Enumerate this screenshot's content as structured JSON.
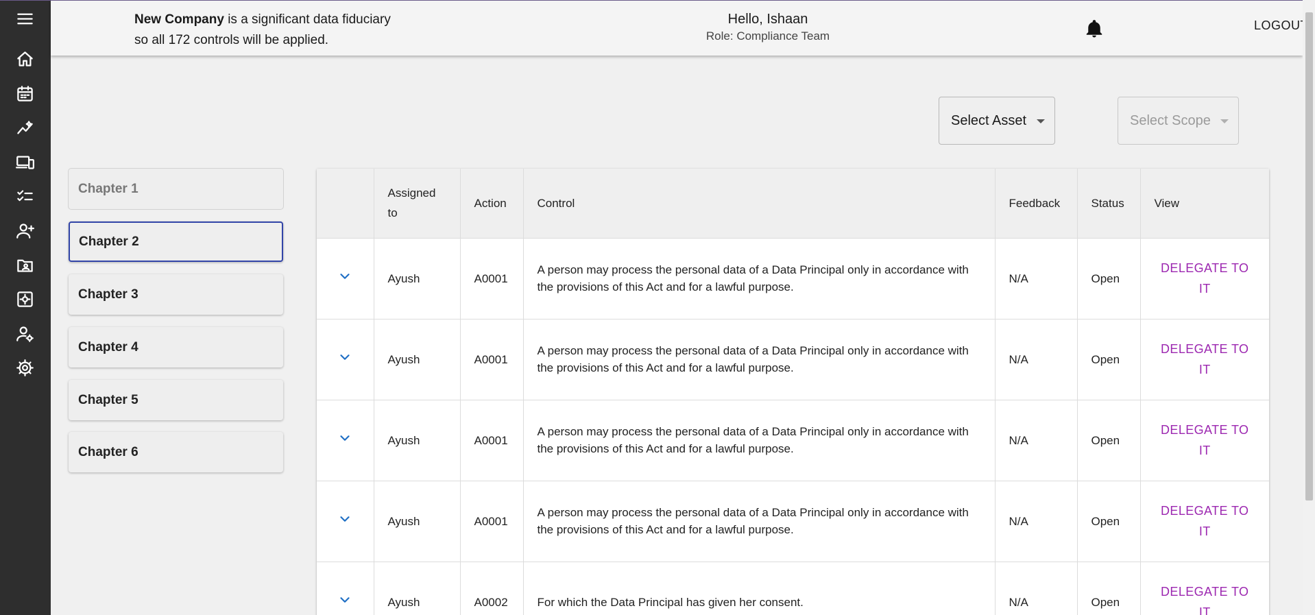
{
  "header": {
    "company_name": "New Company",
    "company_msg_rest": " is a significant data fiduciary",
    "company_msg_line2": "so all 172 controls will be applied.",
    "greeting": "Hello, Ishaan",
    "role": "Role: Compliance Team",
    "logout_label": "LOGOUT",
    "bell_icon": "bell-icon"
  },
  "rail": {
    "items": [
      {
        "icon": "menu-icon"
      },
      {
        "icon": "home-icon"
      },
      {
        "icon": "calendar-icon"
      },
      {
        "icon": "analytics-icon"
      },
      {
        "icon": "devices-icon"
      },
      {
        "icon": "checklist-icon"
      },
      {
        "icon": "add-user-icon"
      },
      {
        "icon": "folder-user-icon"
      },
      {
        "icon": "settings-box-icon"
      },
      {
        "icon": "user-settings-icon"
      },
      {
        "icon": "gear-icon"
      }
    ]
  },
  "filters": {
    "asset_label": "Select Asset",
    "scope_label": "Select Scope"
  },
  "chapters": [
    "Chapter 1",
    "Chapter 2",
    "Chapter 3",
    "Chapter 4",
    "Chapter 5",
    "Chapter 6"
  ],
  "table": {
    "headers": {
      "assigned": "Assigned to",
      "action": "Action",
      "control": "Control",
      "feedback": "Feedback",
      "status": "Status",
      "view": "View"
    },
    "rows": [
      {
        "assigned": "Ayush",
        "action": "A0001",
        "control": "A person may process the personal data of a Data Principal only in accordance with the provisions of this Act and for a lawful purpose.",
        "feedback": "N/A",
        "status": "Open",
        "view": "DELEGATE TO IT"
      },
      {
        "assigned": "Ayush",
        "action": "A0001",
        "control": "A person may process the personal data of a Data Principal only in accordance with the provisions of this Act and for a lawful purpose.",
        "feedback": "N/A",
        "status": "Open",
        "view": "DELEGATE TO IT"
      },
      {
        "assigned": "Ayush",
        "action": "A0001",
        "control": "A person may process the personal data of a Data Principal only in accordance with the provisions of this Act and for a lawful purpose.",
        "feedback": "N/A",
        "status": "Open",
        "view": "DELEGATE TO IT"
      },
      {
        "assigned": "Ayush",
        "action": "A0001",
        "control": "A person may process the personal data of a Data Principal only in accordance with the provisions of this Act and for a lawful purpose.",
        "feedback": "N/A",
        "status": "Open",
        "view": "DELEGATE TO IT"
      },
      {
        "assigned": "Ayush",
        "action": "A0002",
        "control": "For which the Data Principal has given her consent.",
        "feedback": "N/A",
        "status": "Open",
        "view": "DELEGATE TO IT"
      }
    ]
  },
  "colors": {
    "rail_bg": "#2e2e2e",
    "delegate": "#9c27b0",
    "chevron": "#1f6fc5",
    "active_chapter_border": "#3245a8"
  }
}
